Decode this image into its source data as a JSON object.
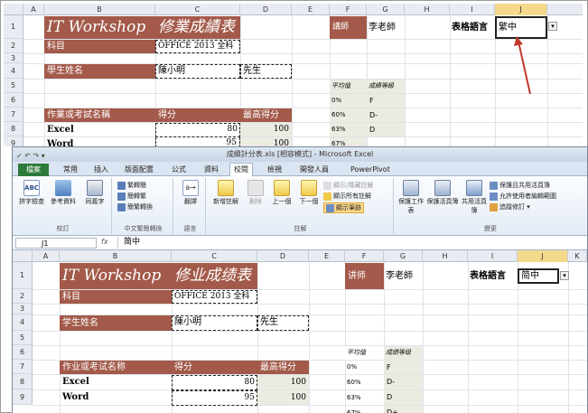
{
  "back_sheet": {
    "columns": [
      "A",
      "B",
      "C",
      "D",
      "E",
      "F",
      "G",
      "H",
      "I",
      "J"
    ],
    "rows": [
      "1",
      "2",
      "3",
      "4",
      "5",
      "6",
      "7",
      "8",
      "9"
    ],
    "title_left": "IT Workshop",
    "title_right": "修業成績表",
    "subject_label": "科目",
    "subject_value": "OFFICE 2013 全科",
    "student_label": "學生姓名",
    "student_value": "陳小明",
    "honorific": "先生",
    "teacher_label": "講師",
    "teacher_value": "李老師",
    "avg_label": "平均值",
    "grade_label": "成績等級",
    "hw_label": "作業或考試名稱",
    "score_label": "得分",
    "max_label": "最高得分",
    "lang_label": "表格語言",
    "lang_value": "繁中",
    "pct": [
      "0%",
      "60%",
      "63%",
      "67%"
    ],
    "grades": [
      "F",
      "D-",
      "D"
    ],
    "items": [
      "Excel",
      "Word"
    ],
    "scores": [
      "80",
      "95"
    ],
    "maxes": [
      "100",
      "100"
    ]
  },
  "window": {
    "title": "成績計分表.xls [相容模式] - Microsoft Excel",
    "qat": "✓ ↶ ↷ ▾",
    "tabs": [
      "檔案",
      "常用",
      "插入",
      "版面配置",
      "公式",
      "資料",
      "校閱",
      "檢視",
      "開發人員",
      "PowerPivot"
    ],
    "ribbon": {
      "spelling": "拼字檢查",
      "research": "參考資料",
      "thesaurus": "同義字",
      "group_proofing": "校訂",
      "to_trad": "繁轉簡",
      "to_simp": "簡轉繁",
      "convert": "簡繁轉換",
      "group_chinese": "中文繁簡轉換",
      "translate": "翻譯",
      "group_language": "語言",
      "new_comment": "新增註解",
      "delete": "刪除",
      "prev": "上一個",
      "next": "下一個",
      "show_hide_comment": "顯示/隱藏註解",
      "show_all_comments": "顯示所有註解",
      "show_ink": "顯示筆跡",
      "group_comments": "註解",
      "protect_sheet": "保護工作表",
      "protect_workbook": "保護活頁簿",
      "share_workbook": "共用活頁簿",
      "protect_share": "保護且共用活頁簿",
      "allow_edit": "允許使用者編輯範圍",
      "track_changes": "追蹤修訂",
      "group_changes": "變更"
    },
    "name_box": "J1",
    "fx": "fx",
    "formula_value": "简中"
  },
  "front_sheet": {
    "columns": [
      "A",
      "B",
      "C",
      "D",
      "E",
      "F",
      "G",
      "H",
      "I",
      "J",
      "K"
    ],
    "rows": [
      "1",
      "2",
      "3",
      "4",
      "5",
      "6",
      "7",
      "8",
      "9"
    ],
    "title_left": "IT Workshop",
    "title_right": "修业成绩表",
    "subject_label": "科目",
    "subject_value": "OFFICE 2013 全科",
    "student_label": "学生姓名",
    "student_value": "陳小明",
    "honorific": "先生",
    "teacher_label": "讲师",
    "teacher_value": "李老師",
    "avg_label": "平均值",
    "grade_label": "成绩等级",
    "hw_label": "作业或考试名称",
    "score_label": "得分",
    "max_label": "最高得分",
    "lang_label": "表格語言",
    "lang_value": "简中",
    "pct": [
      "0%",
      "60%",
      "63%",
      "67%"
    ],
    "grades": [
      "F",
      "D-",
      "D",
      "D+"
    ],
    "items": [
      "Excel",
      "Word"
    ],
    "scores": [
      "80",
      "95"
    ],
    "maxes": [
      "100",
      "100"
    ]
  },
  "colors": {
    "brown": "#a35a4a",
    "beige": "#ecebe2",
    "file_tab": "#2c7b3a",
    "arrow": "#c0392b"
  }
}
